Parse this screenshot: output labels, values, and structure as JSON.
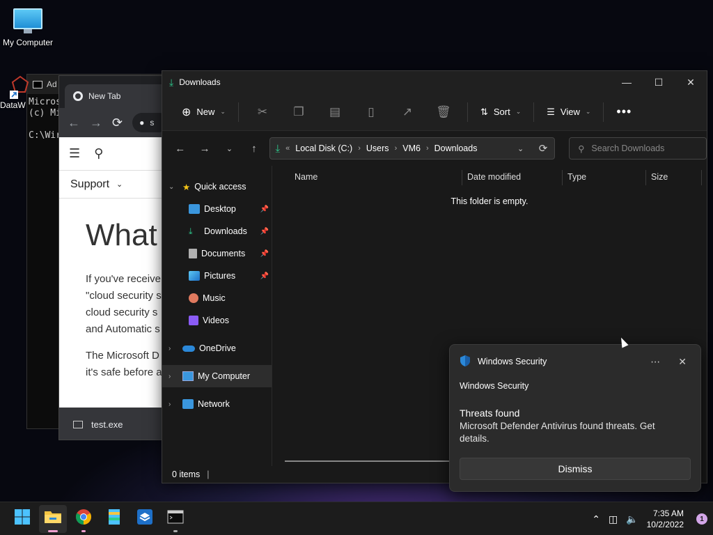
{
  "desktop": {
    "icons": [
      {
        "label": "My Computer"
      },
      {
        "label": "DataW"
      }
    ]
  },
  "cmd": {
    "title": "Ad",
    "lines": "Micros\n(c) Mi\n\nC:\\Wir"
  },
  "chrome": {
    "tab_title": "New Tab",
    "address_partial": "s",
    "support_label": "Support",
    "heading_partial": "What",
    "paragraph1": "If you've receive\n\"cloud security s\ncloud security s\nand Automatic s",
    "paragraph2": "The Microsoft D\nit's safe before a",
    "download_file": "test.exe"
  },
  "explorer": {
    "title": "Downloads",
    "toolbar": {
      "new_label": "New",
      "sort_label": "Sort",
      "view_label": "View"
    },
    "breadcrumb": [
      "Local Disk (C:)",
      "Users",
      "VM6",
      "Downloads"
    ],
    "breadcrumb_overflow": "«",
    "search_placeholder": "Search Downloads",
    "nav": {
      "quick_access": "Quick access",
      "items": [
        {
          "label": "Desktop",
          "icon": "desktop-icon",
          "color": "#3a96dd"
        },
        {
          "label": "Downloads",
          "icon": "download-icon",
          "color": "#2ecc8f"
        },
        {
          "label": "Documents",
          "icon": "document-icon",
          "color": "#b0b0b0"
        },
        {
          "label": "Pictures",
          "icon": "pictures-icon",
          "color": "#3a96dd"
        },
        {
          "label": "Music",
          "icon": "music-icon",
          "color": "#e07a5f"
        },
        {
          "label": "Videos",
          "icon": "videos-icon",
          "color": "#8b5cf6"
        }
      ],
      "onedrive": "OneDrive",
      "my_computer": "My Computer",
      "network": "Network"
    },
    "columns": [
      "Name",
      "Date modified",
      "Type",
      "Size"
    ],
    "empty_message": "This folder is empty.",
    "status": "0 items"
  },
  "toast": {
    "app": "Windows Security",
    "source": "Windows Security",
    "title": "Threats found",
    "body": "Microsoft Defender Antivirus found threats. Get details.",
    "button": "Dismiss"
  },
  "taskbar": {
    "time": "7:35 AM",
    "date": "10/2/2022",
    "notification_count": "1"
  }
}
